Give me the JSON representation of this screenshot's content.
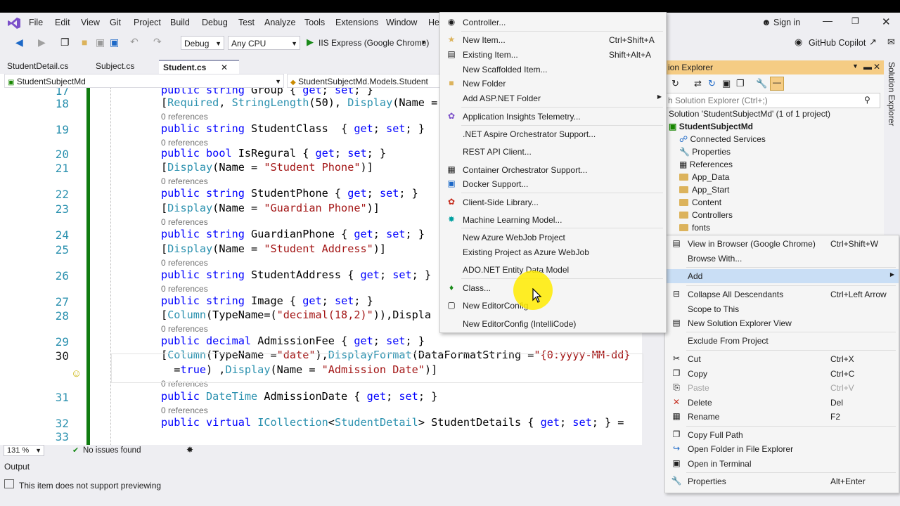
{
  "menu": {
    "items": [
      "File",
      "Edit",
      "View",
      "Git",
      "Project",
      "Build",
      "Debug",
      "Test",
      "Analyze",
      "Tools",
      "Extensions",
      "Window",
      "He"
    ],
    "sign_in": "Sign in",
    "copilot": "GitHub Copilot"
  },
  "toolbar": {
    "config": "Debug",
    "platform": "Any CPU",
    "run_target": "IIS Express (Google Chrome)"
  },
  "tabs": [
    {
      "label": "StudentDetail.cs",
      "active": false
    },
    {
      "label": "Subject.cs",
      "active": false
    },
    {
      "label": "Student.cs",
      "active": true
    }
  ],
  "navbar": {
    "project": "StudentSubjectMd",
    "class": "StudentSubjectMd.Models.Student"
  },
  "editor": {
    "lines": [
      {
        "num": "17",
        "code": "public string Group { get; set; }"
      },
      {
        "num": "18",
        "code": "[Required, StringLength(50), Display(Name ="
      },
      {
        "num": "",
        "refs": "0 references"
      },
      {
        "num": "19",
        "code": "public string StudentClass  { get; set; }"
      },
      {
        "num": "",
        "refs": "0 references"
      },
      {
        "num": "20",
        "code": "public bool IsRegural { get; set; }"
      },
      {
        "num": "21",
        "code": "[Display(Name = \"Student Phone\")]"
      },
      {
        "num": "",
        "refs": "0 references"
      },
      {
        "num": "22",
        "code": "public string StudentPhone { get; set; }"
      },
      {
        "num": "23",
        "code": "[Display(Name = \"Guardian Phone\")]"
      },
      {
        "num": "",
        "refs": "0 references"
      },
      {
        "num": "24",
        "code": "public string GuardianPhone { get; set; }"
      },
      {
        "num": "25",
        "code": "[Display(Name = \"Student Address\")]"
      },
      {
        "num": "",
        "refs": "0 references"
      },
      {
        "num": "26",
        "code": "public string StudentAddress { get; set; }"
      },
      {
        "num": "",
        "refs": "0 references"
      },
      {
        "num": "27",
        "code": "public string Image { get; set; }"
      },
      {
        "num": "28",
        "code": "[Column(TypeName=(\"decimal(18,2)\")),Displa"
      },
      {
        "num": "",
        "refs": "0 references"
      },
      {
        "num": "29",
        "code": "public decimal AdmissionFee { get; set; }"
      },
      {
        "num": "30",
        "code": "[Column(TypeName =\"date\"),DisplayFormat(DataFormatString =\"{0:yyyy-MM-dd}"
      },
      {
        "num": "",
        "code": "  =true) ,Display(Name = \"Admission Date\")]"
      },
      {
        "num": "",
        "refs": "0 references"
      },
      {
        "num": "31",
        "code": "public DateTime AdmissionDate { get; set; }"
      },
      {
        "num": "",
        "refs": "0 references"
      },
      {
        "num": "32",
        "code": "public virtual ICollection<StudentDetail> StudentDetails { get; set; } ="
      },
      {
        "num": "33",
        "code": ""
      }
    ]
  },
  "status": {
    "zoom": "131 %",
    "issues": "No issues found"
  },
  "output_label": "Output",
  "bottom_status": "This item does not support previewing",
  "solution_explorer": {
    "title": "ion Explorer",
    "search_placeholder": "h Solution Explorer (Ctrl+;)",
    "solution": "Solution 'StudentSubjectMd' (1 of 1 project)",
    "project": "StudentSubjectMd",
    "nodes": [
      "Connected Services",
      "Properties",
      "References",
      "App_Data",
      "App_Start",
      "Content",
      "Controllers",
      "fonts"
    ],
    "side_label": "Solution Explorer"
  },
  "context_menu": [
    {
      "label": "View in Browser (Google Chrome)",
      "shortcut": "Ctrl+Shift+W",
      "icon": "browser-icon"
    },
    {
      "label": "Browse With...",
      "shortcut": "",
      "icon": ""
    },
    {
      "label": "Add",
      "shortcut": "",
      "icon": "",
      "highlight": true,
      "submenu": true
    },
    {
      "label": "Collapse All Descendants",
      "shortcut": "Ctrl+Left Arrow",
      "icon": "collapse-icon"
    },
    {
      "label": "Scope to This",
      "shortcut": "",
      "icon": ""
    },
    {
      "label": "New Solution Explorer View",
      "shortcut": "",
      "icon": "new-view-icon"
    },
    {
      "label": "Exclude From Project",
      "shortcut": "",
      "icon": ""
    },
    {
      "label": "Cut",
      "shortcut": "Ctrl+X",
      "icon": "cut-icon"
    },
    {
      "label": "Copy",
      "shortcut": "Ctrl+C",
      "icon": "copy-icon"
    },
    {
      "label": "Paste",
      "shortcut": "Ctrl+V",
      "icon": "paste-icon",
      "disabled": true
    },
    {
      "label": "Delete",
      "shortcut": "Del",
      "icon": "delete-icon"
    },
    {
      "label": "Rename",
      "shortcut": "F2",
      "icon": "rename-icon"
    },
    {
      "label": "Copy Full Path",
      "shortcut": "",
      "icon": "copy-path-icon"
    },
    {
      "label": "Open Folder in File Explorer",
      "shortcut": "",
      "icon": "open-folder-icon"
    },
    {
      "label": "Open in Terminal",
      "shortcut": "",
      "icon": "terminal-icon"
    },
    {
      "label": "Properties",
      "shortcut": "Alt+Enter",
      "icon": "wrench-icon"
    }
  ],
  "add_submenu": [
    {
      "label": "Controller...",
      "shortcut": "",
      "icon": "controller-icon"
    },
    {
      "label": "New Item...",
      "shortcut": "Ctrl+Shift+A",
      "icon": "new-item-icon"
    },
    {
      "label": "Existing Item...",
      "shortcut": "Shift+Alt+A",
      "icon": "existing-item-icon"
    },
    {
      "label": "New Scaffolded Item...",
      "shortcut": "",
      "icon": ""
    },
    {
      "label": "New Folder",
      "shortcut": "",
      "icon": "new-folder-icon"
    },
    {
      "label": "Add ASP.NET Folder",
      "shortcut": "",
      "icon": "",
      "submenu": true
    },
    {
      "label": "Application Insights Telemetry...",
      "shortcut": "",
      "icon": "insights-icon"
    },
    {
      "label": ".NET Aspire Orchestrator Support...",
      "shortcut": "",
      "icon": ""
    },
    {
      "label": "REST API Client...",
      "shortcut": "",
      "icon": ""
    },
    {
      "label": "Container Orchestrator Support...",
      "shortcut": "",
      "icon": "container-icon"
    },
    {
      "label": "Docker Support...",
      "shortcut": "",
      "icon": "docker-icon"
    },
    {
      "label": "Client-Side Library...",
      "shortcut": "",
      "icon": "library-icon"
    },
    {
      "label": "Machine Learning Model...",
      "shortcut": "",
      "icon": "ml-icon"
    },
    {
      "label": "New Azure WebJob Project",
      "shortcut": "",
      "icon": ""
    },
    {
      "label": "Existing Project as Azure WebJob",
      "shortcut": "",
      "icon": ""
    },
    {
      "label": "ADO.NET Entity Data Model",
      "shortcut": "",
      "icon": ""
    },
    {
      "label": "Class...",
      "shortcut": "",
      "icon": "class-icon"
    },
    {
      "label": "New EditorConfig",
      "shortcut": "",
      "icon": "editorconfig-icon"
    },
    {
      "label": "New EditorConfig (IntelliCode)",
      "shortcut": "",
      "icon": ""
    }
  ]
}
